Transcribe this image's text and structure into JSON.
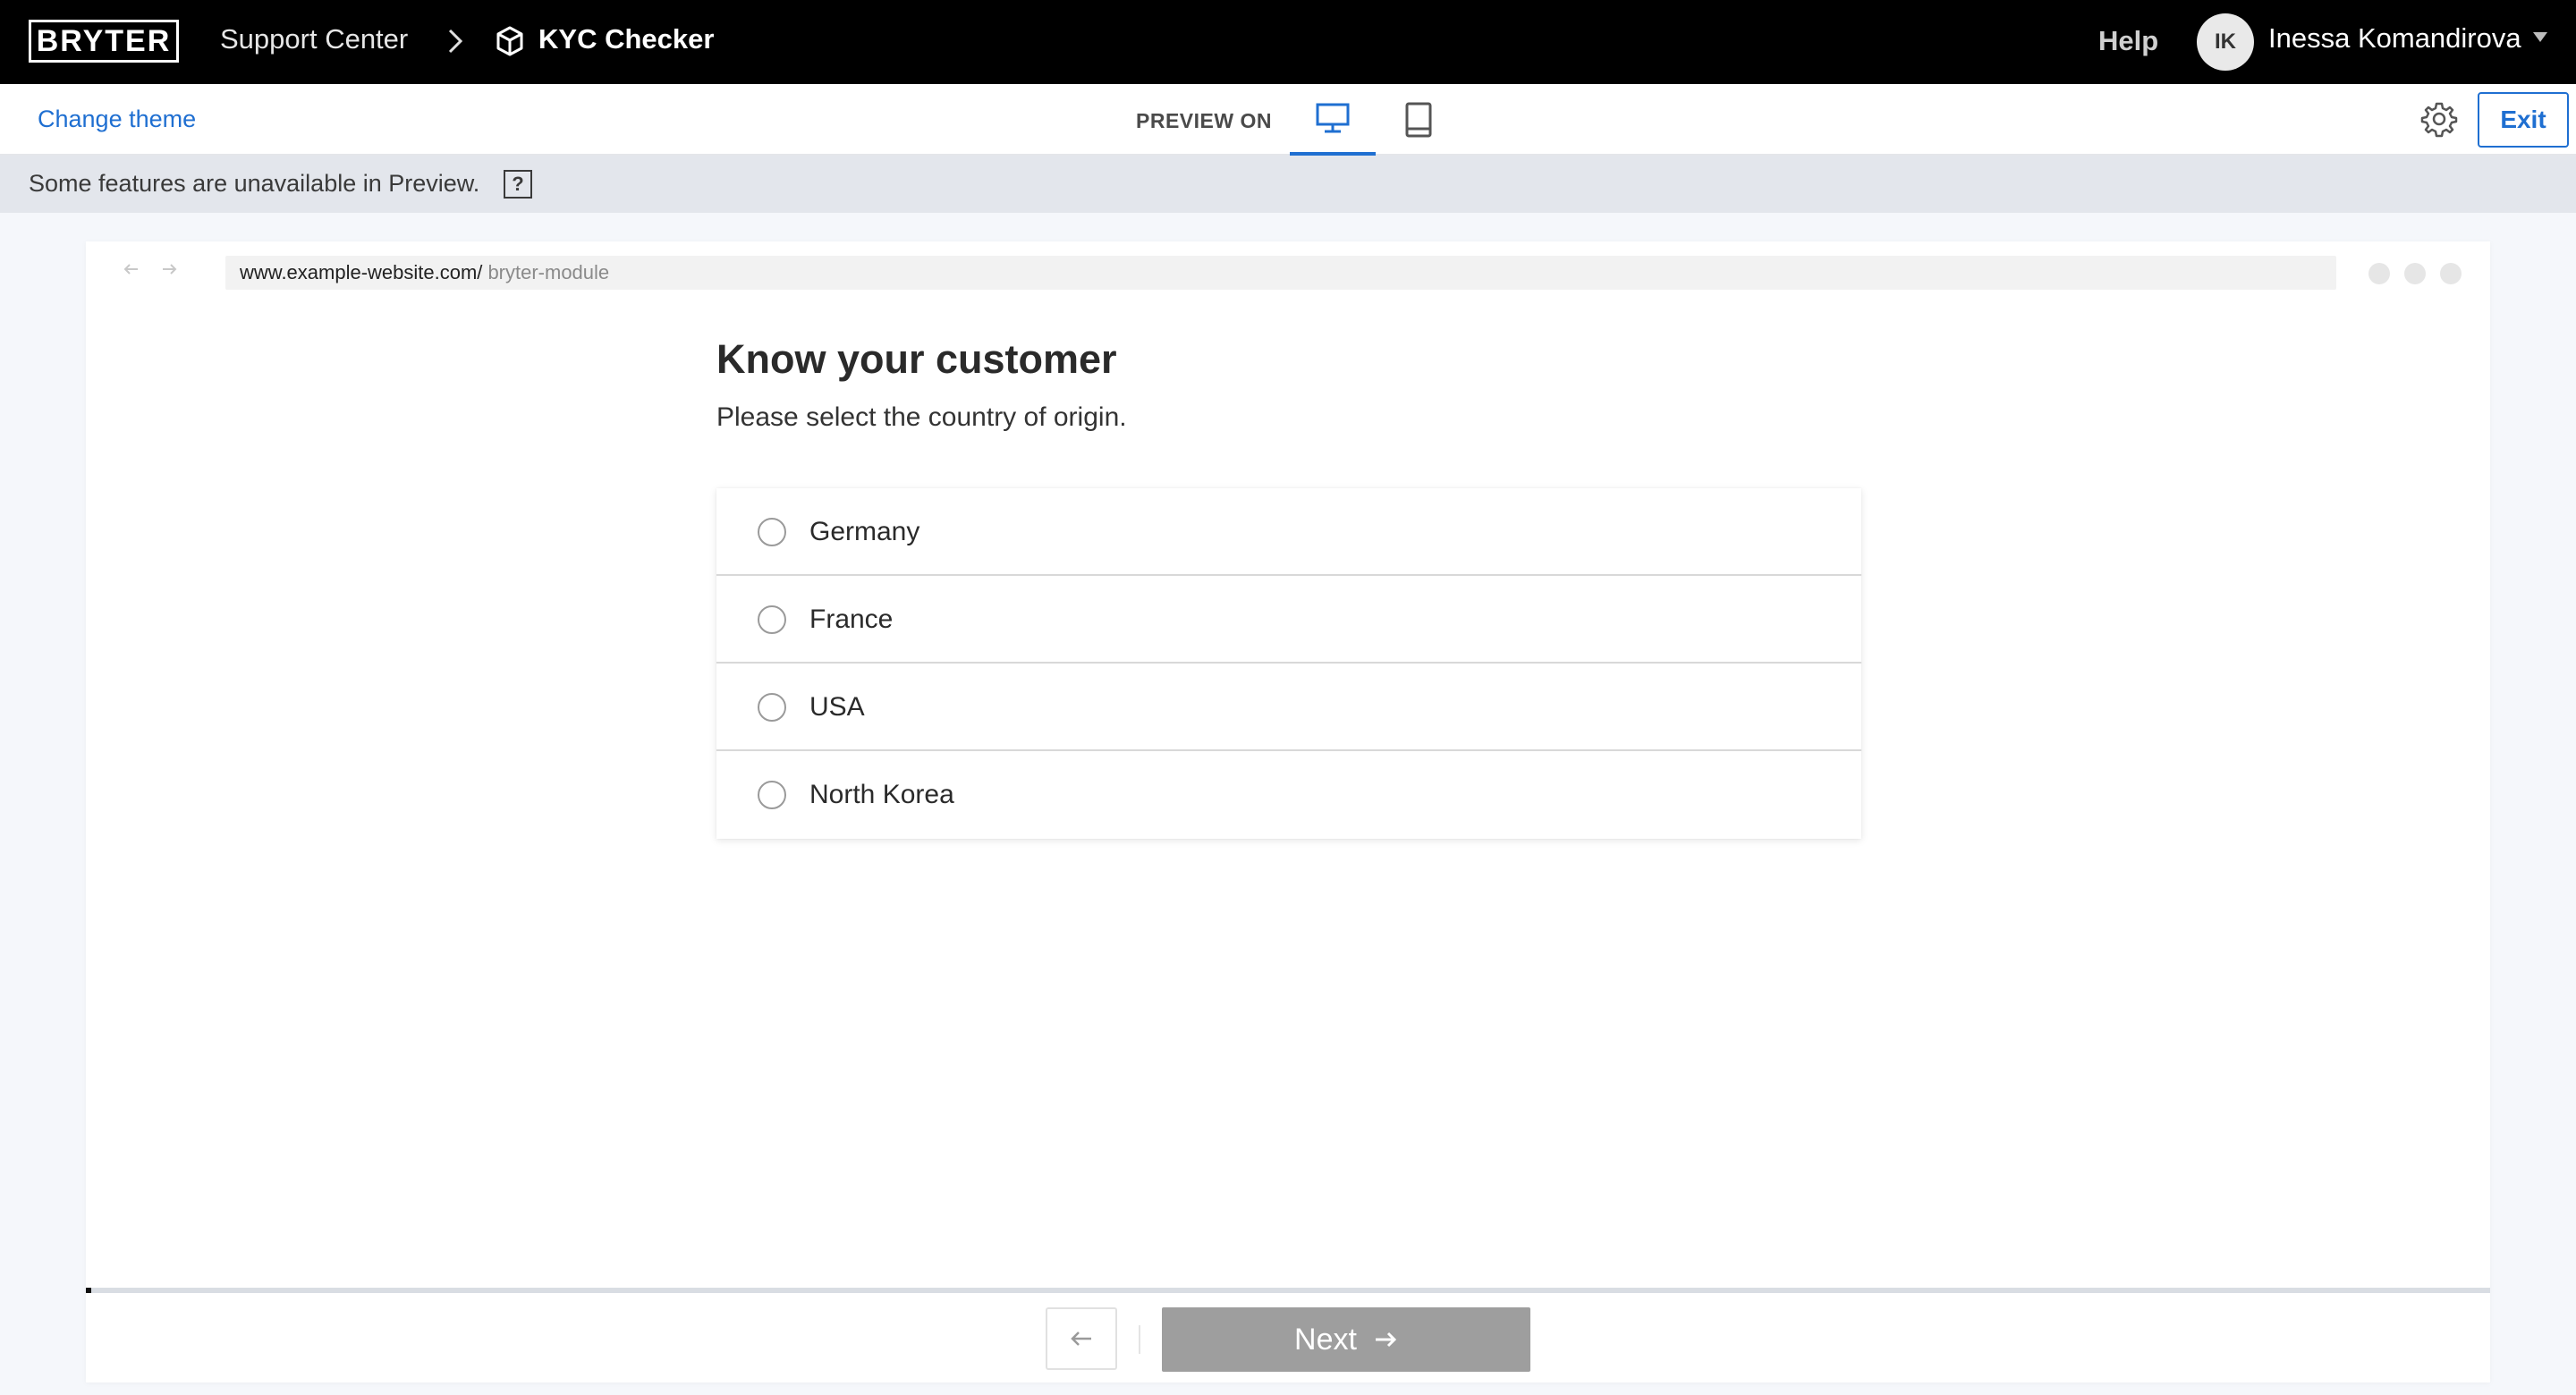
{
  "header": {
    "logo_text": "BRYTER",
    "breadcrumb_parent": "Support Center",
    "breadcrumb_current": "KYC Checker",
    "help_label": "Help",
    "user_initials": "IK",
    "user_name": "Inessa Komandirova",
    "icons": [
      "chevron-right-icon",
      "cube-icon",
      "caret-down-icon"
    ]
  },
  "toolbar": {
    "change_theme_label": "Change theme",
    "preview_on_label": "PREVIEW ON",
    "devices": [
      "desktop",
      "tablet"
    ],
    "active_device": "desktop",
    "exit_label": "Exit",
    "accent_color": "#1f6fd1"
  },
  "info": {
    "text": "Some features are unavailable in Preview.",
    "help_glyph": "?"
  },
  "browser": {
    "url_host": "www.example-website.com/",
    "url_path": "bryter-module"
  },
  "module": {
    "title": "Know your customer",
    "subtitle": "Please select the country of origin.",
    "options": [
      "Germany",
      "France",
      "USA",
      "North Korea"
    ],
    "progress_fraction": 0.002,
    "next_label": "Next"
  }
}
